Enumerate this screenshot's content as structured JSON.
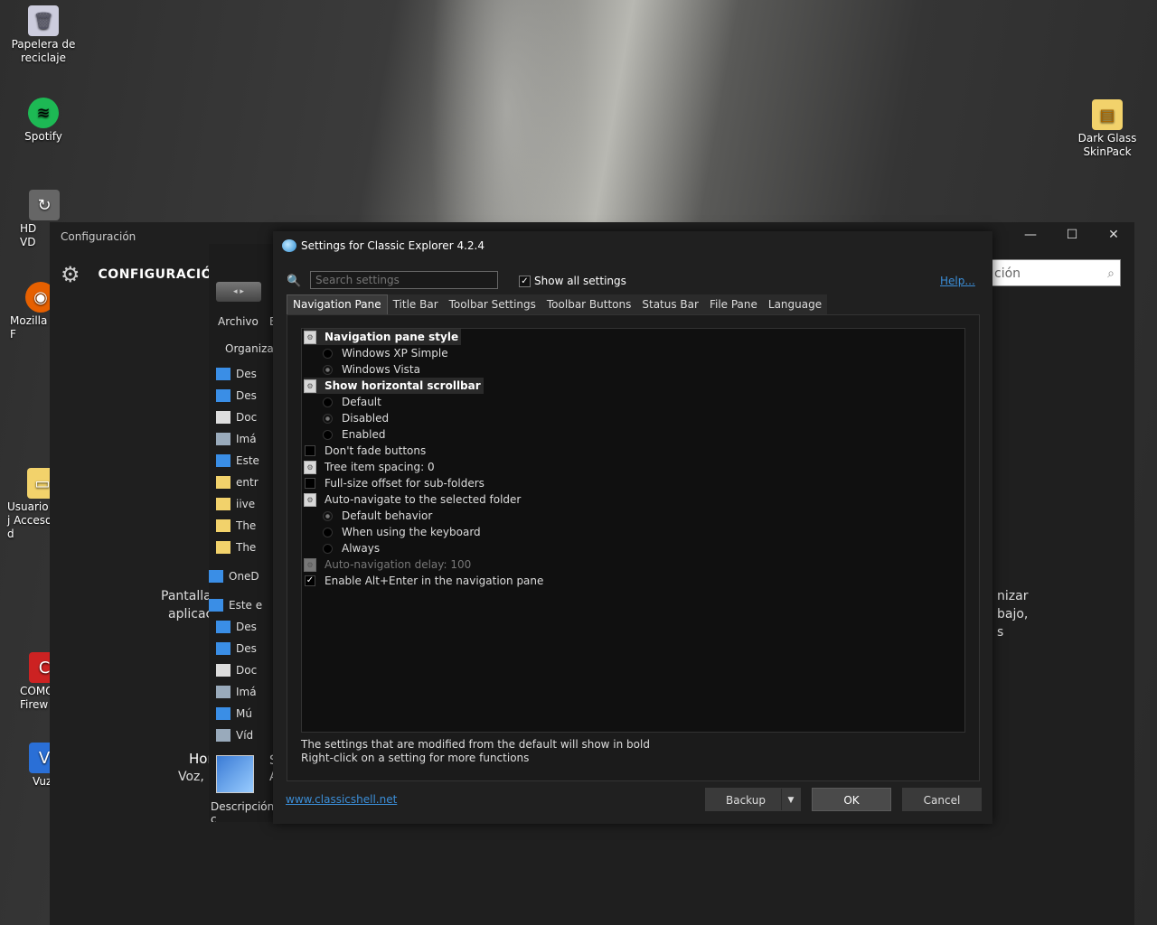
{
  "desktop": {
    "icons": [
      {
        "label": "Papelera de reciclaje",
        "icon": "recycle-bin-icon"
      },
      {
        "label": "Spotify",
        "icon": "spotify-icon"
      },
      {
        "label": "HD VD",
        "icon": "shortcut-icon"
      },
      {
        "label": "Mozilla F",
        "icon": "firefox-icon"
      },
      {
        "label": "Usuario j Acceso d",
        "icon": "folder-icon"
      },
      {
        "label": "COMO Firew",
        "icon": "comodo-icon"
      },
      {
        "label": "Vuz",
        "icon": "vuze-icon"
      },
      {
        "label": "Dark Glass SkinPack",
        "icon": "skinpack-icon"
      }
    ]
  },
  "config_window": {
    "title": "Configuración",
    "heading": "CONFIGURACIÓN",
    "search_placeholder": "ción",
    "left_text_1": "Pantalla,",
    "left_text_2": "aplicac",
    "right_text_1": "nizar",
    "right_text_2": "bajo,",
    "right_text_3": "s",
    "bottom_text_1": "Hor",
    "bottom_text_2": "Voz, r",
    "bottom_text_3": "S",
    "bottom_text_4": "A",
    "desc_label": "Descripción c",
    "minimize": "—",
    "maximize": "☐",
    "close": "✕"
  },
  "explorer": {
    "menu_archivo": "Archivo",
    "menu_e": "E",
    "organizar": "Organizar",
    "tree": [
      {
        "label": "Des",
        "color": "#3a8ee6"
      },
      {
        "label": "Des",
        "color": "#3a8ee6"
      },
      {
        "label": "Doc",
        "color": "#ddd"
      },
      {
        "label": "Imá",
        "color": "#9ab"
      },
      {
        "label": "Este",
        "color": "#3a8ee6"
      },
      {
        "label": "entr",
        "color": "#f2d26b"
      },
      {
        "label": "iive",
        "color": "#f2d26b"
      },
      {
        "label": "The",
        "color": "#f2d26b"
      },
      {
        "label": "The",
        "color": "#f2d26b"
      },
      {
        "label": "OneD",
        "color": "#3a8ee6"
      },
      {
        "label": "Este e",
        "color": "#3a8ee6"
      },
      {
        "label": "Des",
        "color": "#3a8ee6"
      },
      {
        "label": "Des",
        "color": "#3a8ee6"
      },
      {
        "label": "Doc",
        "color": "#ddd"
      },
      {
        "label": "Imá",
        "color": "#9ab"
      },
      {
        "label": "Mú",
        "color": "#3a8ee6"
      },
      {
        "label": "Víd",
        "color": "#9ab"
      }
    ]
  },
  "dialog": {
    "title": "Settings for Classic Explorer 4.2.4",
    "search_placeholder": "Search settings",
    "show_all_label": "Show all settings",
    "help_link": "Help...",
    "tabs": [
      "Navigation Pane",
      "Title Bar",
      "Toolbar Settings",
      "Toolbar Buttons",
      "Status Bar",
      "File Pane",
      "Language"
    ],
    "settings": [
      {
        "label": "Navigation pane style",
        "kind": "gear",
        "bold": true
      },
      {
        "label": "Windows XP Simple",
        "kind": "radio"
      },
      {
        "label": "Windows Vista",
        "kind": "radio-sel"
      },
      {
        "label": "Show horizontal scrollbar",
        "kind": "gear",
        "bold": true
      },
      {
        "label": "Default",
        "kind": "radio"
      },
      {
        "label": "Disabled",
        "kind": "radio-sel"
      },
      {
        "label": "Enabled",
        "kind": "radio"
      },
      {
        "label": "Don't fade buttons",
        "kind": "box"
      },
      {
        "label": "Tree item spacing: 0",
        "kind": "gear"
      },
      {
        "label": "Full-size offset for sub-folders",
        "kind": "box"
      },
      {
        "label": "Auto-navigate to the selected folder",
        "kind": "gear"
      },
      {
        "label": "Default behavior",
        "kind": "radio-sel"
      },
      {
        "label": "When using the keyboard",
        "kind": "radio"
      },
      {
        "label": "Always",
        "kind": "radio"
      },
      {
        "label": "Auto-navigation delay: 100",
        "kind": "gear-disabled"
      },
      {
        "label": "Enable Alt+Enter in the navigation pane",
        "kind": "box-checked"
      }
    ],
    "footnote_1": "The settings that are modified from the default will show in bold",
    "footnote_2": "Right-click on a setting for more functions",
    "site_link": "www.classicshell.net",
    "backup_label": "Backup",
    "ok_label": "OK",
    "cancel_label": "Cancel"
  }
}
